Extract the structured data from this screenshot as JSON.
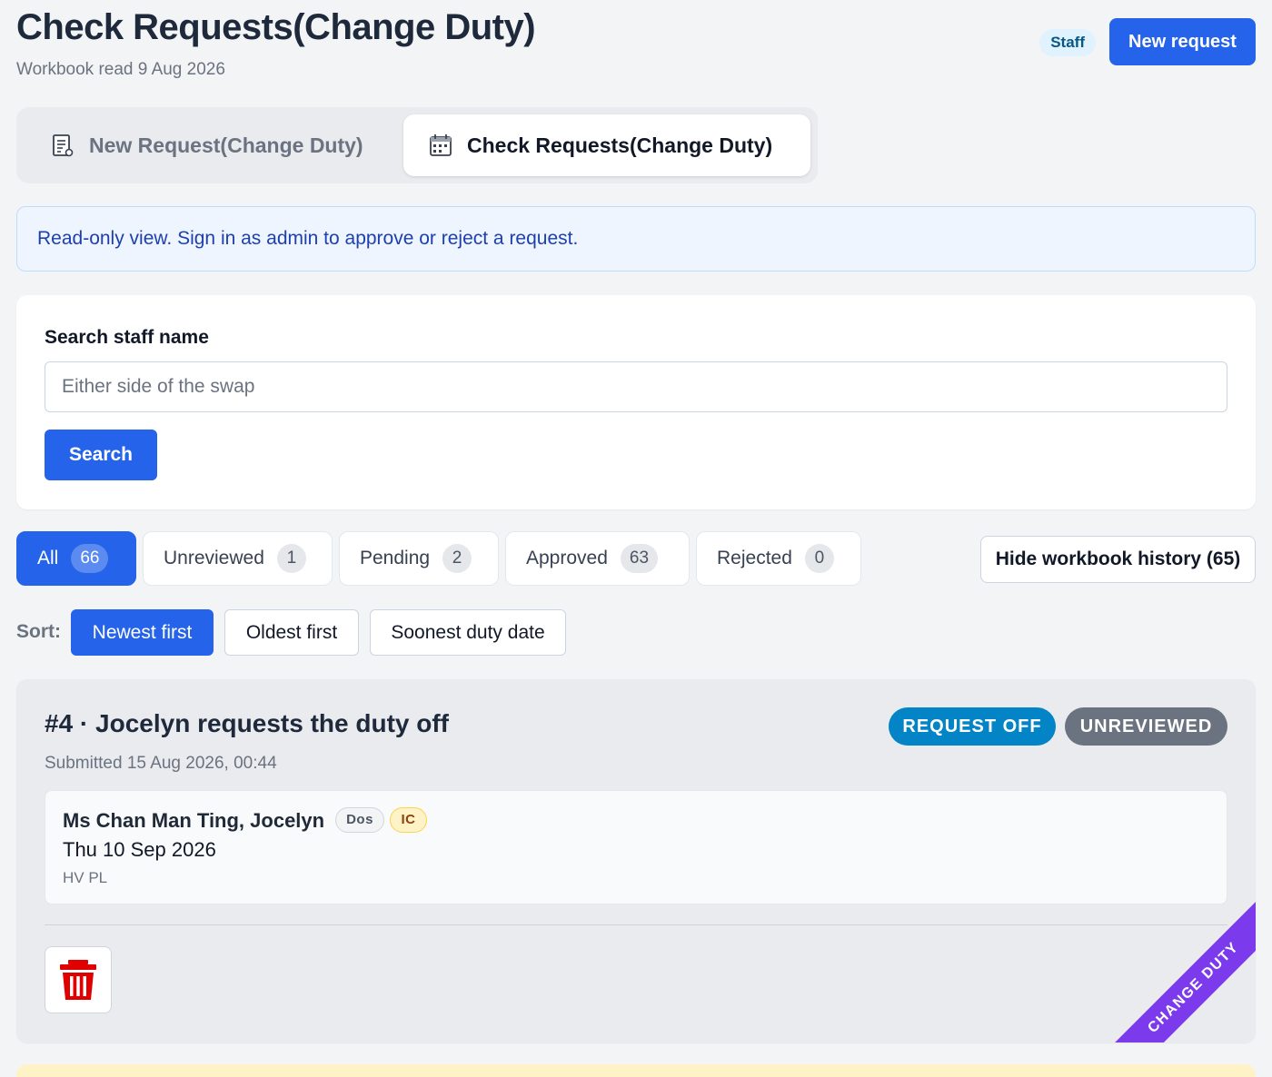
{
  "header": {
    "title": "Check Requests(Change Duty)",
    "subtitle": "Workbook read 9 Aug 2026",
    "role_badge": "Staff",
    "new_request_label": "New request"
  },
  "tabs": [
    {
      "label": "New Request(Change Duty)",
      "icon": "notepad-icon",
      "active": false
    },
    {
      "label": "Check Requests(Change Duty)",
      "icon": "calendar-icon",
      "active": true
    }
  ],
  "notice": "Read-only view. Sign in as admin to approve or reject a request.",
  "search": {
    "label": "Search staff name",
    "placeholder": "Either side of the swap",
    "button_label": "Search"
  },
  "filters": [
    {
      "label": "All",
      "count": "66",
      "active": true
    },
    {
      "label": "Unreviewed",
      "count": "1",
      "active": false
    },
    {
      "label": "Pending",
      "count": "2",
      "active": false
    },
    {
      "label": "Approved",
      "count": "63",
      "active": false
    },
    {
      "label": "Rejected",
      "count": "0",
      "active": false
    }
  ],
  "history_button": "Hide workbook history (65)",
  "sort": {
    "label": "Sort:",
    "options": [
      {
        "label": "Newest first",
        "active": true
      },
      {
        "label": "Oldest first",
        "active": false
      },
      {
        "label": "Soonest duty date",
        "active": false
      }
    ]
  },
  "request": {
    "title": "#4 · Jocelyn requests the duty off",
    "submitted": "Submitted 15 Aug 2026, 00:44",
    "type_pill": "REQUEST OFF",
    "status_pill": "UNREVIEWED",
    "staff": {
      "name": "Ms Chan Man Ting, Jocelyn",
      "tags": [
        "Dos",
        "IC"
      ],
      "date": "Thu 10 Sep 2026",
      "place": "HV PL"
    },
    "ribbon": "CHANGE DUTY",
    "delete_icon": "trash-icon"
  },
  "colors": {
    "primary": "#2563eb",
    "type_pill": "#0284c7",
    "status_pill": "#6b7280",
    "ribbon": "#7c3aed",
    "delete": "#e00000"
  }
}
